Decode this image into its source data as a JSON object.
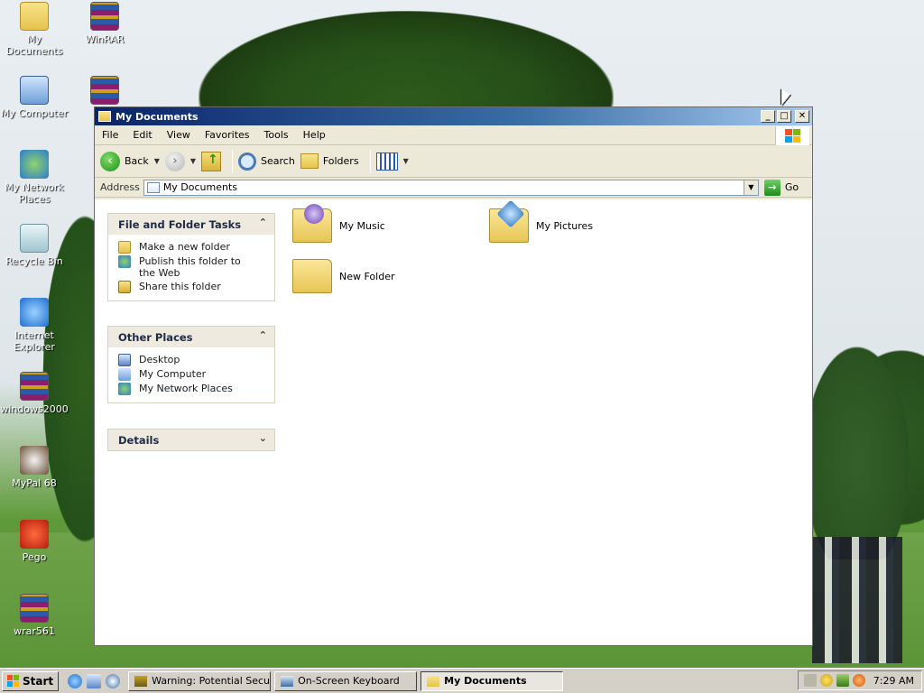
{
  "desktop": {
    "icons": [
      {
        "label": "My Documents",
        "icon": "my-documents-icon"
      },
      {
        "label": "WinRAR",
        "icon": "winrar-icon"
      },
      {
        "label": "My Computer",
        "icon": "my-computer-icon"
      },
      {
        "label": "My Network Places",
        "icon": "network-places-icon"
      },
      {
        "label": "Recycle Bin",
        "icon": "recycle-bin-icon"
      },
      {
        "label": "Internet Explorer",
        "icon": "internet-explorer-icon"
      },
      {
        "label": "windows2000",
        "icon": "winrar-archive-icon"
      },
      {
        "label": "MyPal 68",
        "icon": "mypal-icon"
      },
      {
        "label": "Pego",
        "icon": "pego-icon"
      },
      {
        "label": "wrar561",
        "icon": "winrar-archive-icon"
      }
    ]
  },
  "window": {
    "title": "My Documents",
    "buttons": {
      "minimize": "_",
      "maximize": "□",
      "close": "✕"
    }
  },
  "menu": [
    "File",
    "Edit",
    "View",
    "Favorites",
    "Tools",
    "Help"
  ],
  "toolbar": {
    "back": "Back",
    "search": "Search",
    "folders": "Folders"
  },
  "address": {
    "label": "Address",
    "value": "My Documents",
    "go": "Go"
  },
  "tasks": {
    "file_folder": {
      "title": "File and Folder Tasks",
      "items": [
        {
          "label": "Make a new folder",
          "icon": "new-folder-icon"
        },
        {
          "label": "Publish this folder to the Web",
          "icon": "publish-web-icon"
        },
        {
          "label": "Share this folder",
          "icon": "share-folder-icon"
        }
      ]
    },
    "other_places": {
      "title": "Other Places",
      "items": [
        {
          "label": "Desktop",
          "icon": "desktop-icon"
        },
        {
          "label": "My Computer",
          "icon": "my-computer-icon"
        },
        {
          "label": "My Network Places",
          "icon": "network-places-icon"
        }
      ]
    },
    "details": {
      "title": "Details"
    }
  },
  "files": [
    {
      "label": "My Music",
      "icon": "music-folder-icon"
    },
    {
      "label": "My Pictures",
      "icon": "pictures-folder-icon"
    },
    {
      "label": "New Folder",
      "icon": "folder-icon"
    }
  ],
  "taskbar": {
    "start": "Start",
    "tasks": [
      {
        "label": "Warning: Potential Secur...",
        "active": false
      },
      {
        "label": "On-Screen Keyboard",
        "active": false
      },
      {
        "label": "My Documents",
        "active": true
      }
    ],
    "clock": "7:29 AM"
  },
  "colors": {
    "title_bar_start": "#0a246a",
    "title_bar_end": "#a6caf0",
    "panel_header": "#eeeae0",
    "window_face": "#ece9d8"
  }
}
